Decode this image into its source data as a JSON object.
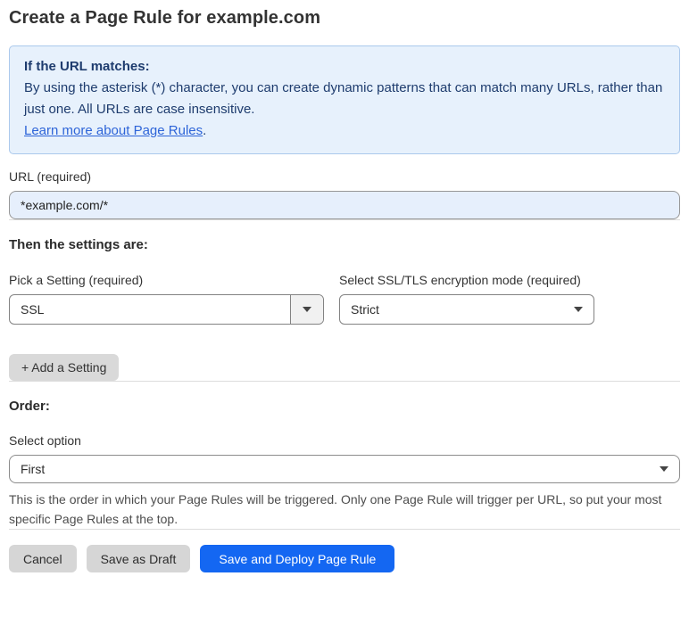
{
  "page": {
    "title": "Create a Page Rule for example.com"
  },
  "info_box": {
    "heading": "If the URL matches:",
    "body": "By using the asterisk (*) character, you can create dynamic patterns that can match many URLs, rather than just one. All URLs are case insensitive.",
    "link_text": "Learn more about Page Rules",
    "link_suffix": "."
  },
  "url_field": {
    "label": "URL (required)",
    "value": "*example.com/*"
  },
  "settings": {
    "heading": "Then the settings are:",
    "setting_picker": {
      "label": "Pick a Setting (required)",
      "value": "SSL"
    },
    "ssl_mode_picker": {
      "label": "Select SSL/TLS encryption mode (required)",
      "value": "Strict"
    },
    "add_setting_label": "+ Add a Setting"
  },
  "order": {
    "heading": "Order:",
    "label": "Select option",
    "value": "First",
    "help": "This is the order in which your Page Rules will be triggered. Only one Page Rule will trigger per URL, so put your most specific Page Rules at the top."
  },
  "footer": {
    "cancel_label": "Cancel",
    "save_draft_label": "Save as Draft",
    "save_deploy_label": "Save and Deploy Page Rule"
  },
  "colors": {
    "primary_blue": "#1467f2",
    "info_background": "#e7f1fc",
    "info_border": "#abc9ec",
    "info_text": "#1e3c6e",
    "link_blue": "#2d64d8",
    "url_input_background": "#e6effc",
    "gray_button": "#d6d6d6"
  }
}
